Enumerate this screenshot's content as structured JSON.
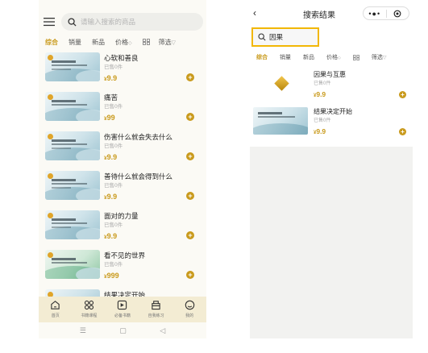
{
  "left": {
    "search": {
      "placeholder": "请输入搜索的商品"
    },
    "filters": [
      {
        "label": "综合",
        "active": true
      },
      {
        "label": "销量",
        "active": false
      },
      {
        "label": "新品",
        "active": false
      },
      {
        "label": "价格",
        "active": false,
        "icon": "sort-arrows"
      },
      {
        "label": "",
        "icon": "grid-icon"
      },
      {
        "label": "筛选",
        "active": false,
        "icon": "funnel"
      }
    ],
    "items": [
      {
        "title": "心软和善良",
        "sold": "已售0件",
        "currency": "¥",
        "price": "9.9"
      },
      {
        "title": "痛苦",
        "sold": "已售0件",
        "currency": "¥",
        "price": "99"
      },
      {
        "title": "伤害什么就会失去什么",
        "sold": "已售0件",
        "currency": "¥",
        "price": "9.9"
      },
      {
        "title": "善待什么就会得到什么",
        "sold": "已售0件",
        "currency": "¥",
        "price": "9.9"
      },
      {
        "title": "面对的力量",
        "sold": "已售0件",
        "currency": "¥",
        "price": "9.9"
      },
      {
        "title": "看不见的世界",
        "sold": "已售0件",
        "currency": "¥",
        "price": "999"
      },
      {
        "title": "结果决定开始",
        "sold": "",
        "currency": "",
        "price": ""
      }
    ],
    "add_symbol": "+",
    "tabbar": [
      {
        "label": "首页",
        "icon": "home-icon"
      },
      {
        "label": "书籍课程",
        "icon": "apps-icon"
      },
      {
        "label": "必备书籍",
        "icon": "book-icon"
      },
      {
        "label": "自我练习",
        "icon": "practice-icon"
      },
      {
        "label": "我的",
        "icon": "profile-icon"
      }
    ],
    "sysnav": {
      "menu": "☰",
      "home": "▢",
      "back": "◁"
    }
  },
  "right": {
    "header": {
      "back": "‹",
      "title": "搜索结果",
      "more": "•●•"
    },
    "search": {
      "value": "因果"
    },
    "filters": [
      {
        "label": "综合",
        "active": true
      },
      {
        "label": "销量",
        "active": false
      },
      {
        "label": "新品",
        "active": false
      },
      {
        "label": "价格",
        "active": false,
        "icon": "sort-arrows"
      },
      {
        "label": "",
        "icon": "grid-icon"
      },
      {
        "label": "筛选",
        "active": false,
        "icon": "funnel"
      }
    ],
    "results": [
      {
        "title": "因果与互惠",
        "sold": "已售0件",
        "currency": "¥",
        "price": "9.9"
      },
      {
        "title": "结果决定开始",
        "sold": "已售0件",
        "currency": "¥",
        "price": "9.9"
      }
    ],
    "add_symbol": "+"
  },
  "colors": {
    "accent": "#c99a1c",
    "highlight_border": "#f2b705",
    "tabbar_bg": "#f3ecd3"
  }
}
